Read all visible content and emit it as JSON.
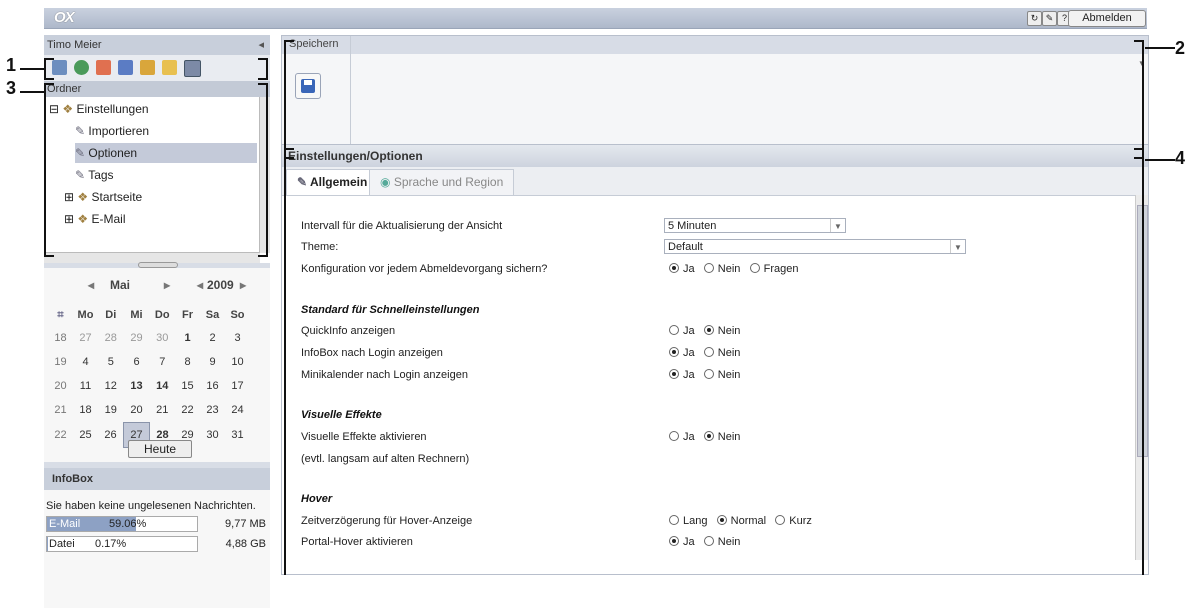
{
  "topbar": {
    "logo": "OX",
    "logout": "Abmelden",
    "icons": [
      "refresh-icon",
      "tools-icon",
      "help-icon"
    ]
  },
  "left": {
    "user": "Timo Meier",
    "collapse": "◂",
    "folder_header": "Ordner",
    "tree": [
      {
        "label": "Einstellungen",
        "icon": "settings-folder-icon",
        "expander": "⊟"
      },
      {
        "label": "Importieren",
        "icon": "wrench-icon"
      },
      {
        "label": "Optionen",
        "icon": "wrench-icon"
      },
      {
        "label": "Tags",
        "icon": "wrench-icon"
      },
      {
        "label": "Startseite",
        "icon": "settings-folder-icon",
        "expander": "⊞"
      },
      {
        "label": "E-Mail",
        "icon": "settings-folder-icon",
        "expander": "⊞"
      }
    ]
  },
  "calendar": {
    "month": "Mai",
    "year": "2009",
    "prev": "◂",
    "next": "▸",
    "weekdays": [
      "Mo",
      "Di",
      "Mi",
      "Do",
      "Fr",
      "Sa",
      "So"
    ],
    "weeks": [
      {
        "wk": "18",
        "days": [
          "27",
          "28",
          "29",
          "30",
          "1",
          "2",
          "3"
        ]
      },
      {
        "wk": "19",
        "days": [
          "4",
          "5",
          "6",
          "7",
          "8",
          "9",
          "10"
        ]
      },
      {
        "wk": "20",
        "days": [
          "11",
          "12",
          "13",
          "14",
          "15",
          "16",
          "17"
        ]
      },
      {
        "wk": "21",
        "days": [
          "18",
          "19",
          "20",
          "21",
          "22",
          "23",
          "24"
        ]
      },
      {
        "wk": "22",
        "days": [
          "25",
          "26",
          "27",
          "28",
          "29",
          "30",
          "31"
        ]
      }
    ],
    "today_button": "Heute"
  },
  "infobox": {
    "title": "InfoBox",
    "message": "Sie haben keine ungelesenen Nachrichten.",
    "quota": [
      {
        "label": "E-Mail",
        "percent": "59.06%",
        "fill": 0.59,
        "size": "9,77 MB"
      },
      {
        "label": "Datei",
        "percent": "0.17%",
        "fill": 0.0017,
        "size": "4,88 GB"
      }
    ]
  },
  "toolbar": {
    "title": "Speichern"
  },
  "main": {
    "title": "Einstellungen/Optionen",
    "tabs": [
      "Allgemein",
      "Sprache und Region"
    ],
    "rows": {
      "interval_label": "Intervall für die Aktualisierung der Ansicht",
      "interval_value": "5 Minuten",
      "theme_label": "Theme:",
      "theme_value": "Default",
      "backup_label": "Konfiguration vor jedem Abmeldevorgang sichern?",
      "backup_opts": [
        "Ja",
        "Nein",
        "Fragen"
      ],
      "sect_quick": "Standard für Schnelleinstellungen",
      "quickinfo_label": "QuickInfo anzeigen",
      "infobox_label": "InfoBox nach Login anzeigen",
      "minical_label": "Minikalender nach Login anzeigen",
      "sect_visual": "Visuelle Effekte",
      "visual_label": "Visuelle Effekte aktivieren",
      "visual_note": "(evtl. langsam auf alten Rechnern)",
      "sect_hover": "Hover",
      "hover_delay_label": "Zeitverzögerung für Hover-Anzeige",
      "hover_opts": [
        "Lang",
        "Normal",
        "Kurz"
      ],
      "portal_hover_label": "Portal-Hover aktivieren",
      "yes": "Ja",
      "no": "Nein"
    }
  },
  "callouts": [
    "1",
    "2",
    "3",
    "4"
  ]
}
